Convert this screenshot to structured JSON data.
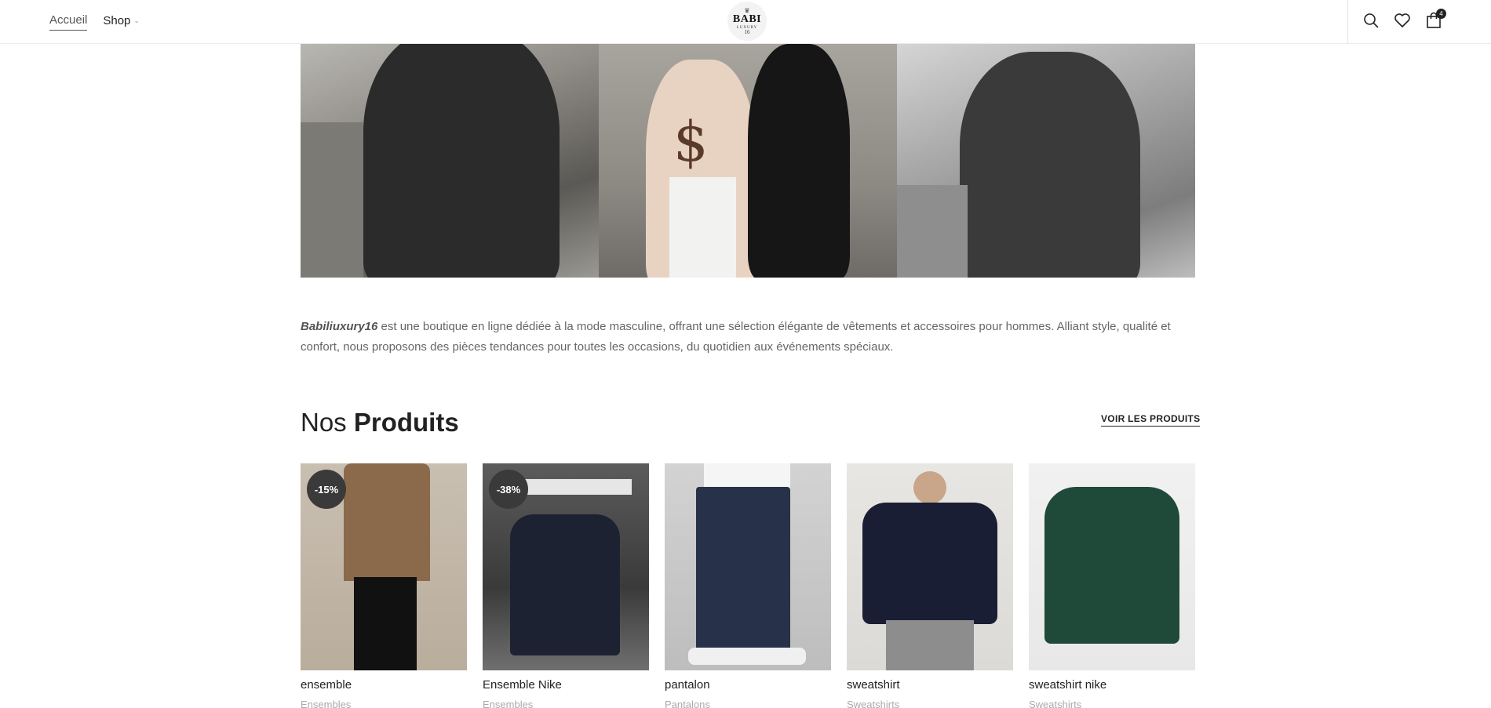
{
  "header": {
    "nav": [
      {
        "label": "Accueil",
        "active": true
      },
      {
        "label": "Shop",
        "active": false
      }
    ],
    "logo": {
      "line1": "BABI",
      "line2": "LUXURY",
      "line3": "16"
    },
    "cart_count": "4"
  },
  "about": {
    "brand": "Babiliuxury16",
    "text": " est une boutique en ligne dédiée à la mode masculine, offrant une sélection élégante de vêtements et accessoires pour hommes. Alliant style, qualité et confort, nous proposons des pièces tendances pour toutes les occasions, du quotidien aux événements spéciaux."
  },
  "products_section": {
    "title_light": "Nos ",
    "title_bold": "Produits",
    "see_all": "VOIR LES PRODUITS",
    "items": [
      {
        "name": "ensemble",
        "category": "Ensembles",
        "badge": "-15%"
      },
      {
        "name": "Ensemble Nike",
        "category": "Ensembles",
        "badge": "-38%"
      },
      {
        "name": "pantalon",
        "category": "Pantalons",
        "badge": ""
      },
      {
        "name": "sweatshirt",
        "category": "Sweatshirts",
        "badge": ""
      },
      {
        "name": "sweatshirt nike",
        "category": "Sweatshirts",
        "badge": ""
      }
    ]
  }
}
